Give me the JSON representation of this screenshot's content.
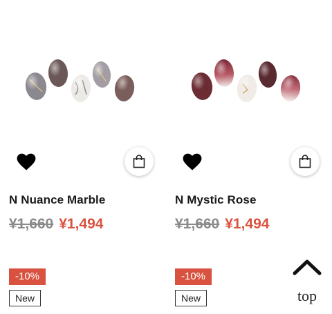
{
  "products": [
    {
      "name": "N Nuance Marble",
      "original_price": "¥1,660",
      "sale_price": "¥1,494",
      "discount_badge": "-10%",
      "new_badge": "New",
      "image_colors": [
        "#8c8890",
        "#6b5757",
        "#e8e6e2",
        "#a49ea4",
        "#7a5e5b"
      ],
      "favorite_icon": "heart-icon",
      "cart_icon": "shopping-bag-icon"
    },
    {
      "name": "N Mystic Rose",
      "original_price": "¥1,660",
      "sale_price": "¥1,494",
      "discount_badge": "-10%",
      "new_badge": "New",
      "image_colors": [
        "#6b2c33",
        "#7a2834",
        "#f0ebe6",
        "#5a2a31",
        "#8a3340"
      ],
      "favorite_icon": "heart-icon",
      "cart_icon": "shopping-bag-icon"
    }
  ],
  "back_to_top": {
    "label": "top",
    "icon": "chevron-up-icon"
  },
  "colors": {
    "accent_red": "#d9523f",
    "strike_gray": "#8a8a8a",
    "text_dark": "#1a1a1a"
  }
}
